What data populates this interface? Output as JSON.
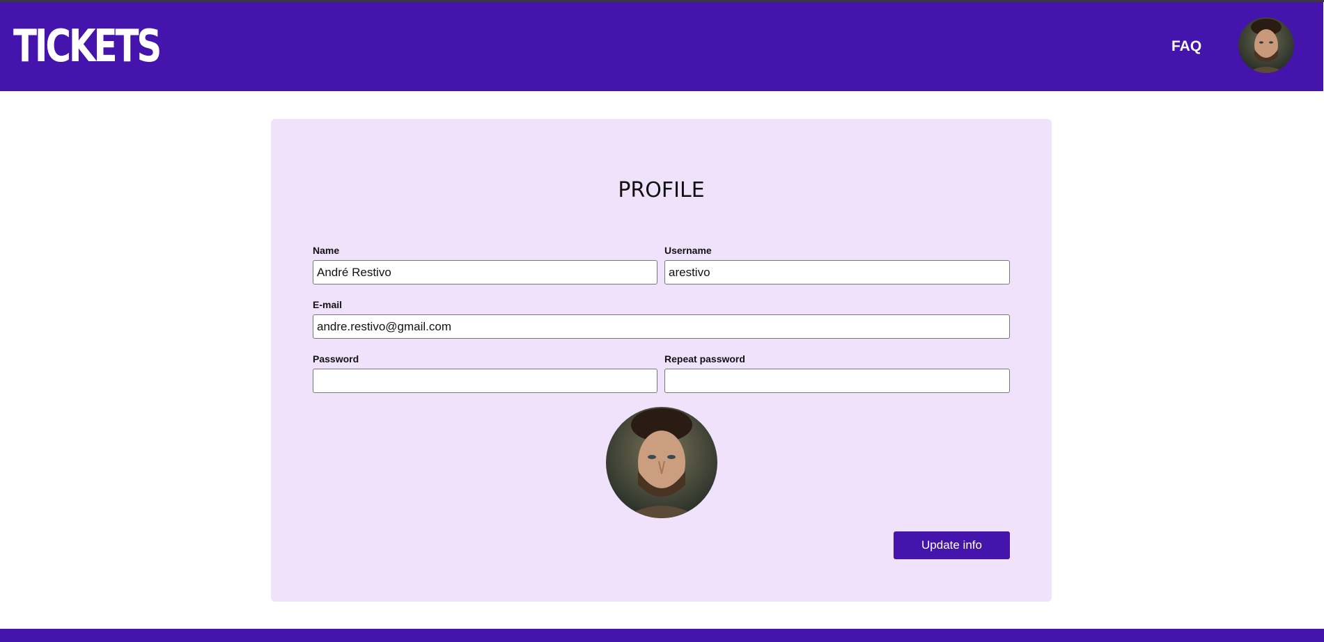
{
  "header": {
    "brand": "TICKETS",
    "nav": {
      "faq_label": "FAQ"
    },
    "avatar_icon": "user-avatar-photo"
  },
  "profile": {
    "title": "PROFILE",
    "fields": {
      "name": {
        "label": "Name",
        "value": "André Restivo"
      },
      "username": {
        "label": "Username",
        "value": "arestivo"
      },
      "email": {
        "label": "E-mail",
        "value": "andre.restivo@gmail.com"
      },
      "password": {
        "label": "Password",
        "value": ""
      },
      "repeat_password": {
        "label": "Repeat password",
        "value": ""
      }
    },
    "avatar_icon": "profile-photo",
    "update_button_label": "Update info"
  },
  "colors": {
    "brand": "#4414ad",
    "card_background": "#f1e2fc"
  }
}
